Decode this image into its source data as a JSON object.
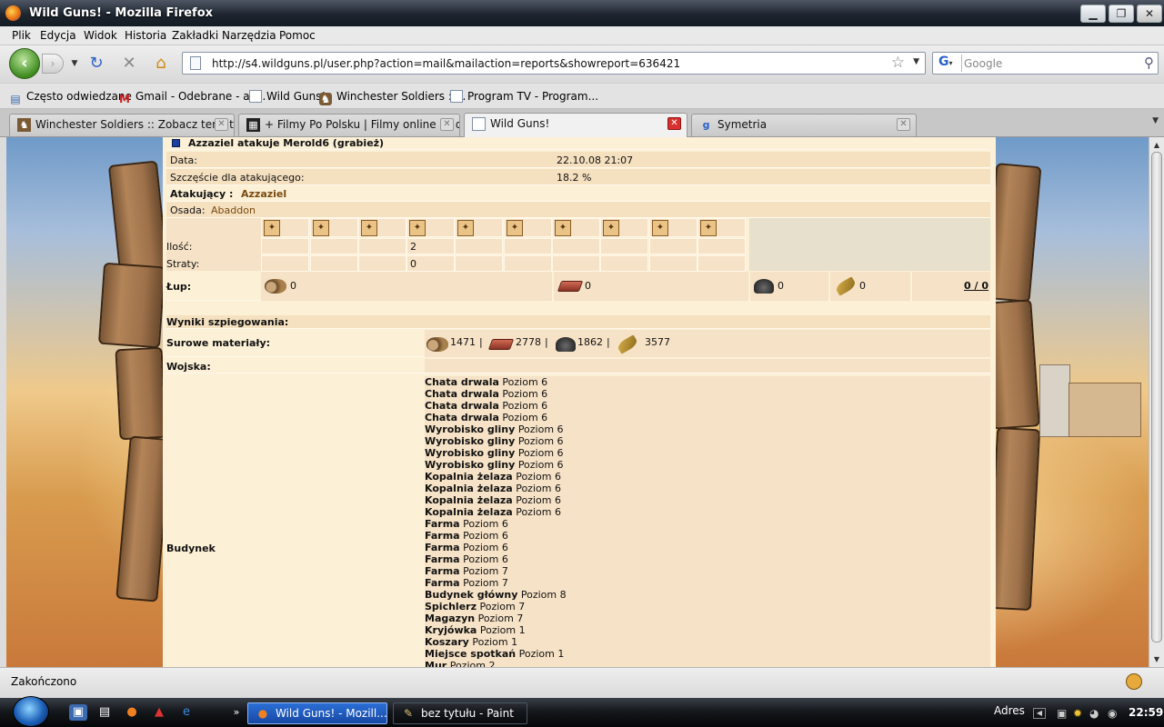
{
  "window": {
    "title": "Wild Guns! - Mozilla Firefox"
  },
  "menu": [
    "Plik",
    "Edycja",
    "Widok",
    "Historia",
    "Zakładki",
    "Narzędzia",
    "Pomoc"
  ],
  "nav": {
    "url": "http://s4.wildguns.pl/user.php?action=mail&mailaction=reports&showreport=636421",
    "search_placeholder": "Google"
  },
  "bookmarks": [
    "Często odwiedzane",
    "Gmail - Odebrane - az...",
    "Wild Guns!",
    "Winchester Soldiers ::...",
    "Program TV - Program..."
  ],
  "tabs": [
    {
      "label": "Winchester Soldiers :: Zobacz temat - 2...",
      "active": false
    },
    {
      "label": "+ Filmy Po Polsku | Filmy online za darm...",
      "active": false
    },
    {
      "label": "Wild Guns!",
      "active": true
    },
    {
      "label": "Symetria",
      "active": false
    }
  ],
  "report": {
    "title": "Azzaziel atakuje Merold6 (grabież)",
    "date_label": "Data:",
    "date_value": "22.10.08 21:07",
    "luck_label": "Szczęście dla atakującego:",
    "luck_value": "18.2 %",
    "attacker_label": "Atakujący :",
    "attacker_name": "Azzaziel",
    "settlement_label": "Osada:",
    "settlement_name": "Abaddon",
    "units": [
      "unit-1-icon",
      "unit-2-icon",
      "unit-3-icon",
      "unit-4-icon",
      "unit-5-icon",
      "unit-6-icon",
      "unit-7-icon",
      "unit-8-icon",
      "unit-9-icon",
      "unit-10-icon"
    ],
    "qty_label": "Ilość:",
    "qty_values": [
      "",
      "",
      "",
      "2",
      "",
      "",
      "",
      "",
      "",
      ""
    ],
    "loss_label": "Straty:",
    "loss_values": [
      "",
      "",
      "",
      "0",
      "",
      "",
      "",
      "",
      "",
      ""
    ],
    "loot_label": "Łup:",
    "loot": {
      "wood": "0",
      "clay": "0",
      "iron": "0",
      "food": "0",
      "total": "0 / 0"
    },
    "spy_label": "Wyniki szpiegowania:",
    "raw_label": "Surowe materiały:",
    "raw": {
      "wood": "1471",
      "clay": "2778",
      "iron": "1862",
      "food": "3577",
      "sep": "|"
    },
    "army_label": "Wojska:",
    "building_label": "Budynek",
    "buildings": [
      {
        "name": "Chata drwala",
        "level": "Poziom 6"
      },
      {
        "name": "Chata drwala",
        "level": "Poziom 6"
      },
      {
        "name": "Chata drwala",
        "level": "Poziom 6"
      },
      {
        "name": "Chata drwala",
        "level": "Poziom 6"
      },
      {
        "name": "Wyrobisko gliny",
        "level": "Poziom 6"
      },
      {
        "name": "Wyrobisko gliny",
        "level": "Poziom 6"
      },
      {
        "name": "Wyrobisko gliny",
        "level": "Poziom 6"
      },
      {
        "name": "Wyrobisko gliny",
        "level": "Poziom 6"
      },
      {
        "name": "Kopalnia żelaza",
        "level": "Poziom 6"
      },
      {
        "name": "Kopalnia żelaza",
        "level": "Poziom 6"
      },
      {
        "name": "Kopalnia żelaza",
        "level": "Poziom 6"
      },
      {
        "name": "Kopalnia żelaza",
        "level": "Poziom 6"
      },
      {
        "name": "Farma",
        "level": "Poziom 6"
      },
      {
        "name": "Farma",
        "level": "Poziom 6"
      },
      {
        "name": "Farma",
        "level": "Poziom 6"
      },
      {
        "name": "Farma",
        "level": "Poziom 6"
      },
      {
        "name": "Farma",
        "level": "Poziom 7"
      },
      {
        "name": "Farma",
        "level": "Poziom 7"
      },
      {
        "name": "Budynek główny",
        "level": "Poziom 8"
      },
      {
        "name": "Spichlerz",
        "level": "Poziom 7"
      },
      {
        "name": "Magazyn",
        "level": "Poziom 7"
      },
      {
        "name": "Kryjówka",
        "level": "Poziom 1"
      },
      {
        "name": "Koszary",
        "level": "Poziom 1"
      },
      {
        "name": "Miejsce spotkań",
        "level": "Poziom 1"
      },
      {
        "name": "Mur",
        "level": "Poziom 2"
      }
    ]
  },
  "status": "Zakończono",
  "taskbar": {
    "items": [
      {
        "label": "Wild Guns! - Mozill...",
        "active": true
      },
      {
        "label": "bez tytułu - Paint",
        "active": false
      }
    ],
    "adres": "Adres",
    "clock": "22:59"
  }
}
